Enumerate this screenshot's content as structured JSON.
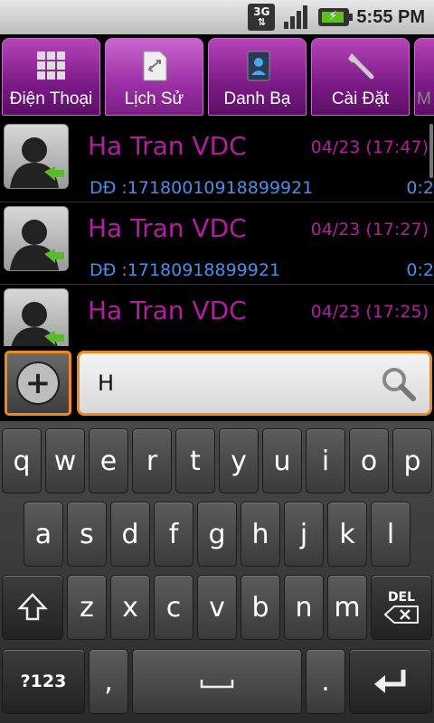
{
  "status_bar": {
    "network": "3G",
    "time": "5:55 PM"
  },
  "tabs": [
    {
      "label": "Điện Thoại",
      "icon": "dialpad-icon"
    },
    {
      "label": "Lịch Sử",
      "icon": "history-icon"
    },
    {
      "label": "Danh Bạ",
      "icon": "contacts-icon"
    },
    {
      "label": "Cài Đặt",
      "icon": "wrench-icon"
    },
    {
      "label": "M",
      "icon": "more-icon"
    }
  ],
  "calls": [
    {
      "name": "Ha Tran VDC",
      "time": "04/23 (17:47)",
      "number": "DĐ :17180010918899921",
      "duration": "0:2"
    },
    {
      "name": "Ha Tran VDC",
      "time": "04/23 (17:27)",
      "number": "DĐ :17180918899921",
      "duration": "0:2"
    },
    {
      "name": "Ha Tran VDC",
      "time": "04/23 (17:25)",
      "number": "",
      "duration": ""
    }
  ],
  "search": {
    "value": "H"
  },
  "keyboard": {
    "row1": [
      "q",
      "w",
      "e",
      "r",
      "t",
      "y",
      "u",
      "i",
      "o",
      "p"
    ],
    "row2": [
      "a",
      "s",
      "d",
      "f",
      "g",
      "h",
      "j",
      "k",
      "l"
    ],
    "row3": [
      "z",
      "x",
      "c",
      "v",
      "b",
      "n",
      "m"
    ],
    "delete_label": "DEL",
    "symbols_label": "?123",
    "comma": ",",
    "period": "."
  },
  "colors": {
    "accent": "#f08a1c",
    "tab": "#9b2fa4",
    "name": "#b21ea0",
    "number": "#4a8ee8"
  }
}
